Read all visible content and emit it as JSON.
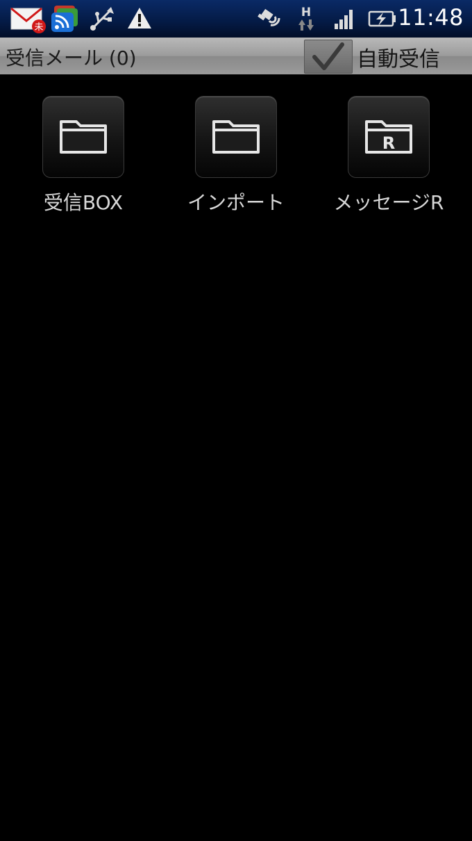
{
  "status_bar": {
    "time": "11:48",
    "icons": [
      "mail-notification-icon",
      "rss-icon",
      "usb-icon",
      "warning-icon",
      "gps-icon",
      "hsdpa-icon",
      "signal-icon",
      "battery-charging-icon"
    ],
    "network_letter": "H",
    "mail_badge": "未"
  },
  "title_bar": {
    "title": "受信メール (0)",
    "auto_receive_label": "自動受信",
    "auto_receive_checked": true
  },
  "folders": [
    {
      "label": "受信BOX",
      "icon": "folder-icon"
    },
    {
      "label": "インポート",
      "icon": "folder-icon"
    },
    {
      "label": "メッセージR",
      "icon": "folder-r-icon",
      "badge": "R"
    }
  ]
}
